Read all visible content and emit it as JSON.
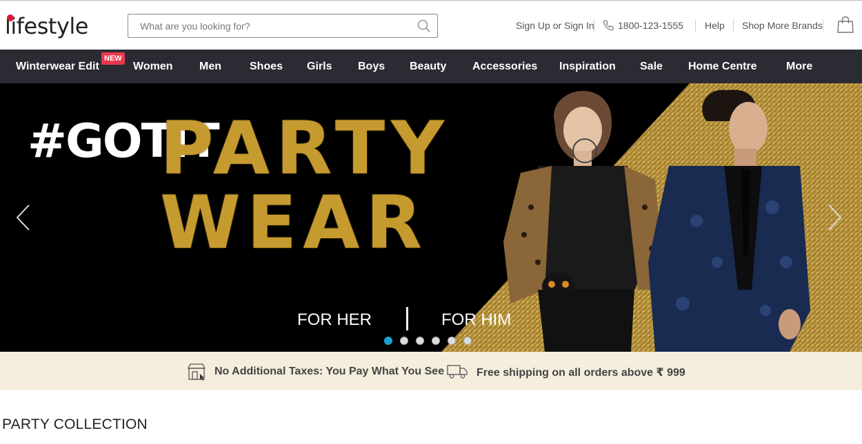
{
  "header": {
    "logo_text": "lifestyle",
    "search_placeholder": "What are you looking for?",
    "signin": "Sign Up or Sign In",
    "phone": "1800-123-1555",
    "help": "Help",
    "shop_more": "Shop More Brands"
  },
  "nav": {
    "items": [
      {
        "label": "Winterwear Edit"
      },
      {
        "label": "Women"
      },
      {
        "label": "Men"
      },
      {
        "label": "Shoes"
      },
      {
        "label": "Girls"
      },
      {
        "label": "Boys"
      },
      {
        "label": "Beauty"
      },
      {
        "label": "Accessories"
      },
      {
        "label": "Inspiration"
      },
      {
        "label": "Sale"
      },
      {
        "label": "Home Centre"
      },
      {
        "label": "More"
      }
    ],
    "badge": "NEW"
  },
  "banner": {
    "hashtag": "#GOTIT",
    "line1": "PARTY",
    "line2": "WEAR",
    "for_her": "FOR HER",
    "for_him": "FOR HIM",
    "slide_count": 6,
    "active_slide": 1
  },
  "strip": {
    "taxes": "No Additional Taxes: You Pay What You See",
    "shipping": "Free shipping on all orders above ₹ 999"
  },
  "section": {
    "title": "PARTY COLLECTION"
  },
  "colors": {
    "nav_bg": "#2b2c33",
    "badge": "#e8384d",
    "strip_bg": "#f5eedd",
    "gold": "#c59a2f",
    "active_dot": "#1a9fd4"
  }
}
